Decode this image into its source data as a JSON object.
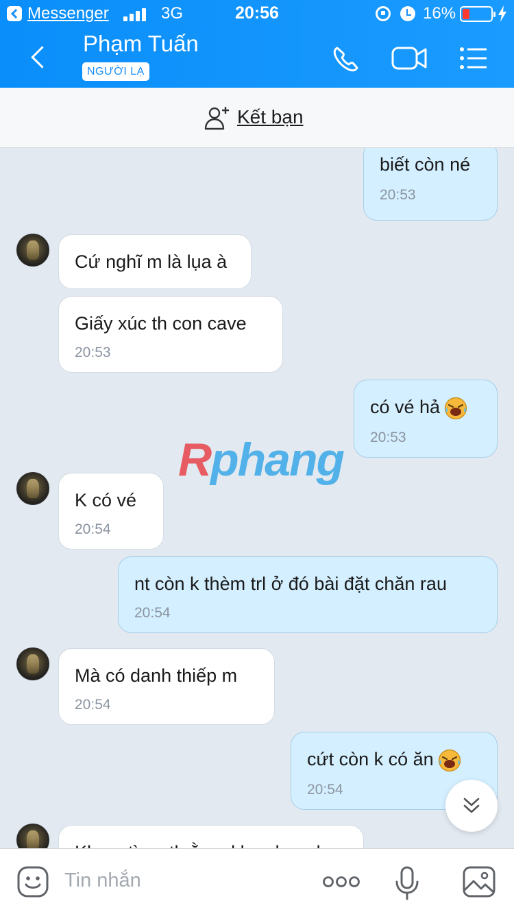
{
  "status_bar": {
    "back_app": "Messenger",
    "network": "3G",
    "time": "20:56",
    "battery_percent": "16%",
    "battery_level": 0.16
  },
  "header": {
    "name": "Phạm Tuấn",
    "badge": "NGƯỜI LẠ"
  },
  "add_friend": {
    "label": "Kết bạn"
  },
  "messages": [
    {
      "direction": "out",
      "text": "biết còn né",
      "time": "20:53"
    },
    {
      "direction": "in",
      "text": "Cứ nghĩ m là lụa à",
      "time": ""
    },
    {
      "direction": "in",
      "text": "Giấy  xúc th con cave",
      "time": "20:53"
    },
    {
      "direction": "out",
      "text": "có vé hả",
      "time": "20:53",
      "emoji": "laughing-crying"
    },
    {
      "direction": "in",
      "text": "K có vé",
      "time": "20:54"
    },
    {
      "direction": "out",
      "text": "nt còn k thèm trl ở đó bài đặt chăn rau",
      "time": "20:54"
    },
    {
      "direction": "in",
      "text": "Mà có danh thiếp m",
      "time": "20:54"
    },
    {
      "direction": "out",
      "text": "cứt còn k có ăn",
      "time": "20:54",
      "emoji": "laughing-crying"
    },
    {
      "direction": "in",
      "text": "Kh..... tì..... th ằ..... kl..... b..... b.....",
      "time": ""
    }
  ],
  "watermark": {
    "first": "R",
    "rest": "phang"
  },
  "input": {
    "placeholder": "Tin nhắn"
  },
  "colors": {
    "header": "#1a93fb",
    "outgoing_bubble": "#d4efff",
    "incoming_bubble": "#ffffff",
    "chat_bg": "#e2e9f0"
  }
}
